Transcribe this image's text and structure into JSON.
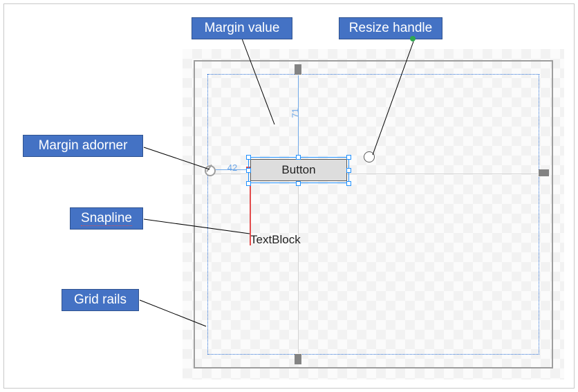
{
  "callouts": {
    "margin_value": "Margin value",
    "resize_handle": "Resize handle",
    "margin_adorner": "Margin adorner",
    "snapline": "Snapline",
    "grid_rails": "Grid rails"
  },
  "designer": {
    "button_text": "Button",
    "textblock_text": "TextBlock",
    "margin_top_value": "71",
    "margin_left_value": "42"
  }
}
